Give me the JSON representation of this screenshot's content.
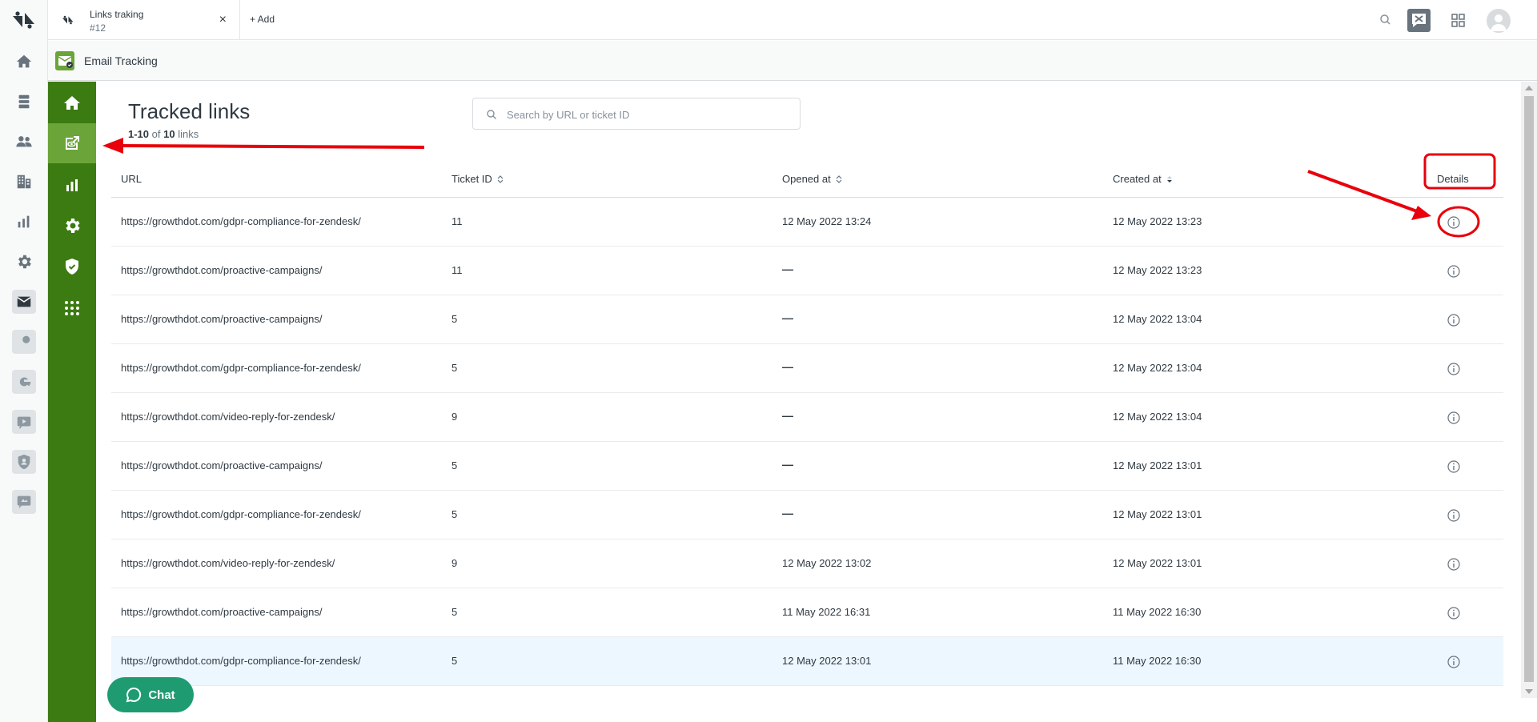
{
  "topbar": {
    "tab_title": "Links traking",
    "tab_subtitle": "#12",
    "tab_close": "×",
    "add_label": "+ Add"
  },
  "app": {
    "title": "Email Tracking"
  },
  "page": {
    "title": "Tracked links",
    "count_range": "1-10",
    "count_of": " of ",
    "count_total": "10",
    "count_suffix": " links"
  },
  "search": {
    "placeholder": "Search by URL or ticket ID",
    "value": ""
  },
  "table": {
    "headers": {
      "url": "URL",
      "ticket": "Ticket ID",
      "opened": "Opened at",
      "created": "Created at",
      "details": "Details"
    },
    "rows": [
      {
        "url": "https://growthdot.com/gdpr-compliance-for-zendesk/",
        "ticket": "11",
        "opened": "12 May 2022 13:24",
        "created": "12 May 2022 13:23"
      },
      {
        "url": "https://growthdot.com/proactive-campaigns/",
        "ticket": "11",
        "opened": "—",
        "created": "12 May 2022 13:23"
      },
      {
        "url": "https://growthdot.com/proactive-campaigns/",
        "ticket": "5",
        "opened": "—",
        "created": "12 May 2022 13:04"
      },
      {
        "url": "https://growthdot.com/gdpr-compliance-for-zendesk/",
        "ticket": "5",
        "opened": "—",
        "created": "12 May 2022 13:04"
      },
      {
        "url": "https://growthdot.com/video-reply-for-zendesk/",
        "ticket": "9",
        "opened": "—",
        "created": "12 May 2022 13:04"
      },
      {
        "url": "https://growthdot.com/proactive-campaigns/",
        "ticket": "5",
        "opened": "—",
        "created": "12 May 2022 13:01"
      },
      {
        "url": "https://growthdot.com/gdpr-compliance-for-zendesk/",
        "ticket": "5",
        "opened": "—",
        "created": "12 May 2022 13:01"
      },
      {
        "url": "https://growthdot.com/video-reply-for-zendesk/",
        "ticket": "9",
        "opened": "12 May 2022 13:02",
        "created": "12 May 2022 13:01"
      },
      {
        "url": "https://growthdot.com/proactive-campaigns/",
        "ticket": "5",
        "opened": "11 May 2022 16:31",
        "created": "11 May 2022 16:30"
      },
      {
        "url": "https://growthdot.com/gdpr-compliance-for-zendesk/",
        "ticket": "5",
        "opened": "12 May 2022 13:01",
        "created": "11 May 2022 16:30"
      }
    ]
  },
  "chat": {
    "label": "Chat"
  },
  "colors": {
    "sidenav_green": "#3c7a12",
    "sidenav_active": "#6ba539",
    "chat_green": "#1f9b72",
    "annotation_red": "#e8000b",
    "row_highlight": "#edf7ff"
  }
}
